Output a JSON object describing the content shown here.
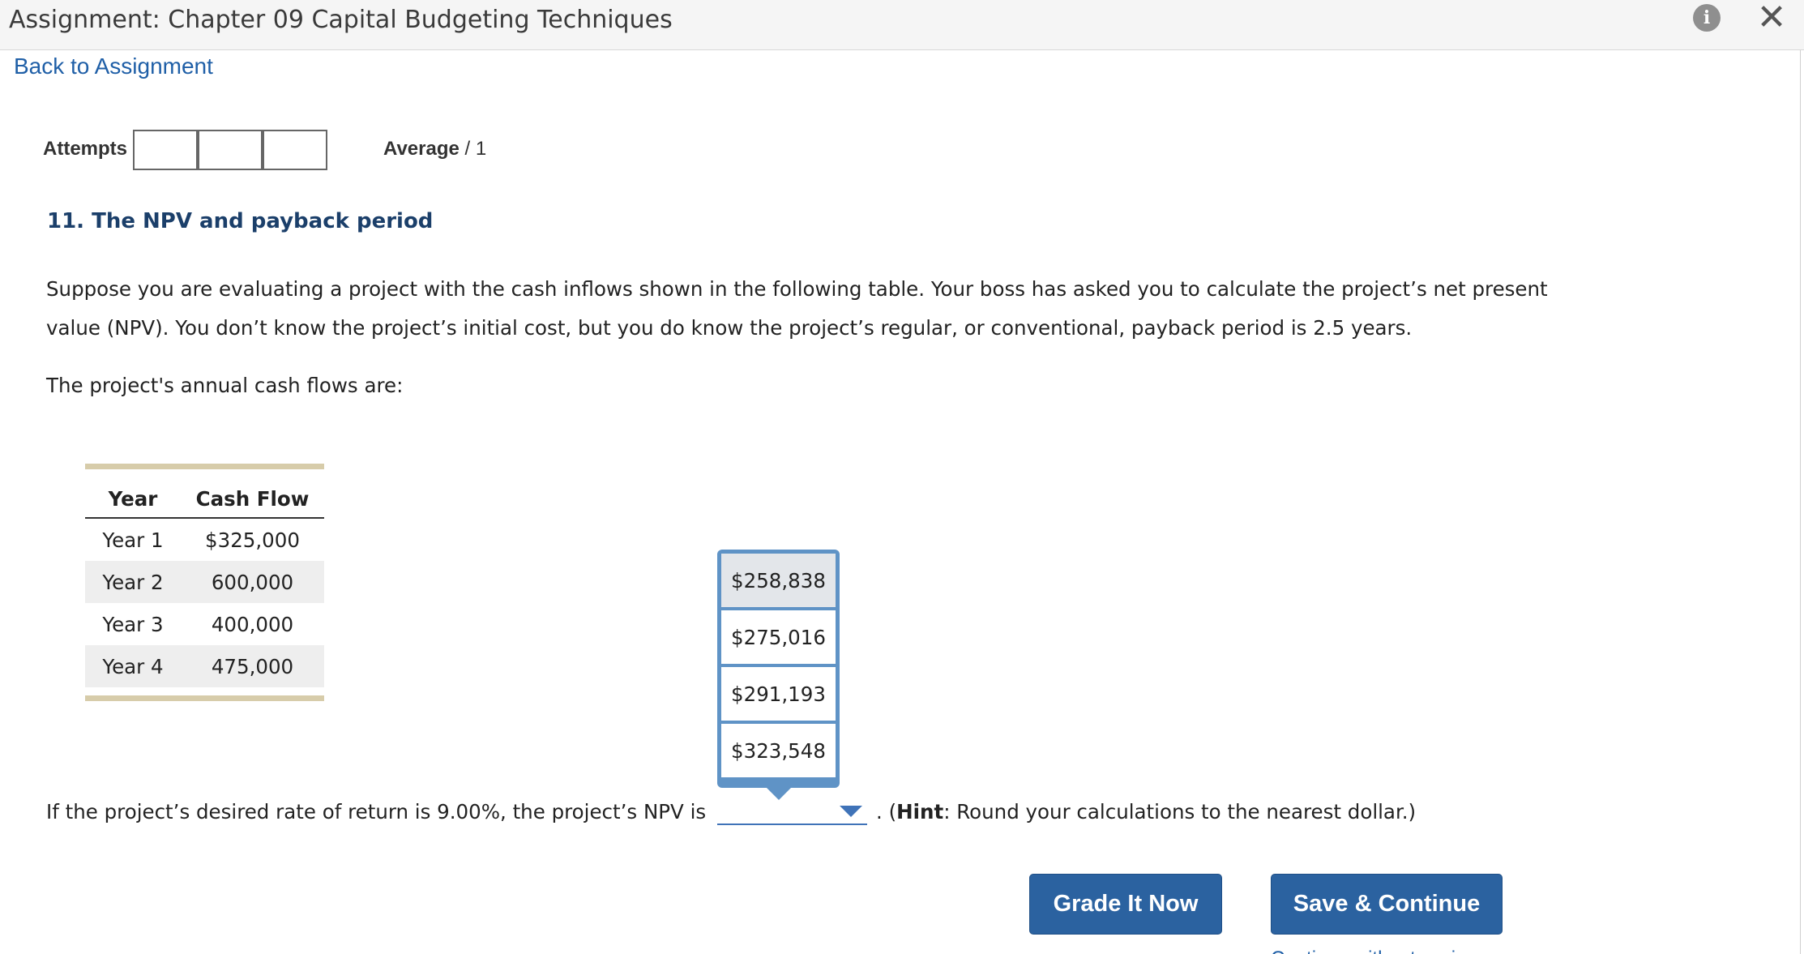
{
  "header": {
    "title": "Assignment: Chapter 09 Capital Budgeting Techniques",
    "info_icon": "info-icon",
    "close_icon": "close-icon",
    "info_glyph": "i",
    "close_glyph": "✕"
  },
  "nav": {
    "back_label": "Back to Assignment"
  },
  "attempts": {
    "label": "Attempts",
    "boxes": [
      "",
      "",
      ""
    ],
    "average_label": "Average",
    "average_value": "/ 1"
  },
  "question": {
    "title": "11. The NPV and payback period",
    "paragraph1": "Suppose you are evaluating a project with the cash inflows shown in the following table. Your boss has asked you to calculate the project’s net present value (NPV). You don’t know the project’s initial cost, but you do know the project’s regular, or conventional, payback period is 2.5 years.",
    "paragraph2": "The project's annual cash flows are:"
  },
  "cash_flow_table": {
    "headers": [
      "Year",
      "Cash Flow"
    ],
    "rows": [
      [
        "Year 1",
        "$325,000"
      ],
      [
        "Year 2",
        "600,000"
      ],
      [
        "Year 3",
        "400,000"
      ],
      [
        "Year 4",
        "475,000"
      ]
    ]
  },
  "npv_question": {
    "prefix": "If the project’s desired rate of return is 9.00%, the project’s NPV is",
    "suffix_dot": ". (",
    "hint_label": "Hint",
    "hint_text": ": Round your calculations to the nearest dollar.)",
    "selected_value": "",
    "options": [
      "$258,838",
      "$275,016",
      "$291,193",
      "$323,548"
    ],
    "highlighted_option_index": 0
  },
  "buttons": {
    "grade_label": "Grade It Now",
    "save_label": "Save & Continue",
    "continue_link": "Continue without saving"
  },
  "colors": {
    "accent": "#2b62a0",
    "link": "#1f5fa7",
    "dropdown_border": "#5f93c6",
    "table_rule": "#d7ccaa"
  }
}
